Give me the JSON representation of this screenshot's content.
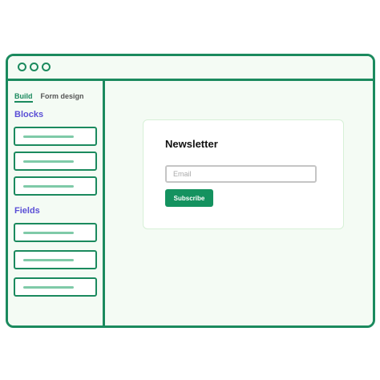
{
  "sidebar": {
    "tabs": [
      {
        "label": "Build",
        "active": true
      },
      {
        "label": "Form design",
        "active": false
      }
    ],
    "blocks_title": "Blocks",
    "fields_title": "Fields"
  },
  "card": {
    "title": "Newsletter",
    "email_placeholder": "Email",
    "subscribe_label": "Subscribe"
  },
  "colors": {
    "accent": "#1b8a5e",
    "button": "#14925f",
    "section_title": "#5b4fd6",
    "background": "#f4fbf4"
  }
}
